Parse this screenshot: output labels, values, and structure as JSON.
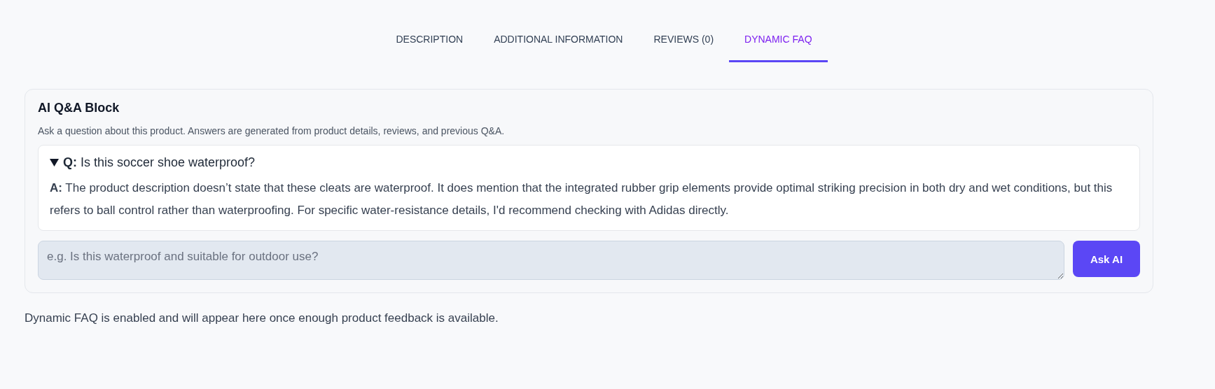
{
  "tabs": [
    {
      "label": "DESCRIPTION",
      "selected": false
    },
    {
      "label": "ADDITIONAL INFORMATION",
      "selected": false
    },
    {
      "label": "REVIEWS (0)",
      "selected": false
    },
    {
      "label": "DYNAMIC FAQ",
      "selected": true
    }
  ],
  "qa_block": {
    "title": "AI Q&A Block",
    "description": "Ask a question about this product. Answers are generated from product details, reviews, and previous Q&A.",
    "items": [
      {
        "expanded": true,
        "question": "**Q:** Is this soccer shoe waterproof?",
        "answer": "**A:** The product description doesn’t state that these cleats are waterproof. It does mention that the integrated rubber grip elements provide optimal striking precision in both dry and wet conditions, but this refers to ball control rather than waterproofing. For specific water-resistance details, I'd recommend checking with Adidas directly."
      }
    ],
    "input": {
      "placeholder": "e.g. Is this waterproof and suitable for outdoor use?"
    },
    "button": "Ask AI"
  },
  "footer_note": "Dynamic FAQ is enabled and will appear here once enough product feedback is available."
}
